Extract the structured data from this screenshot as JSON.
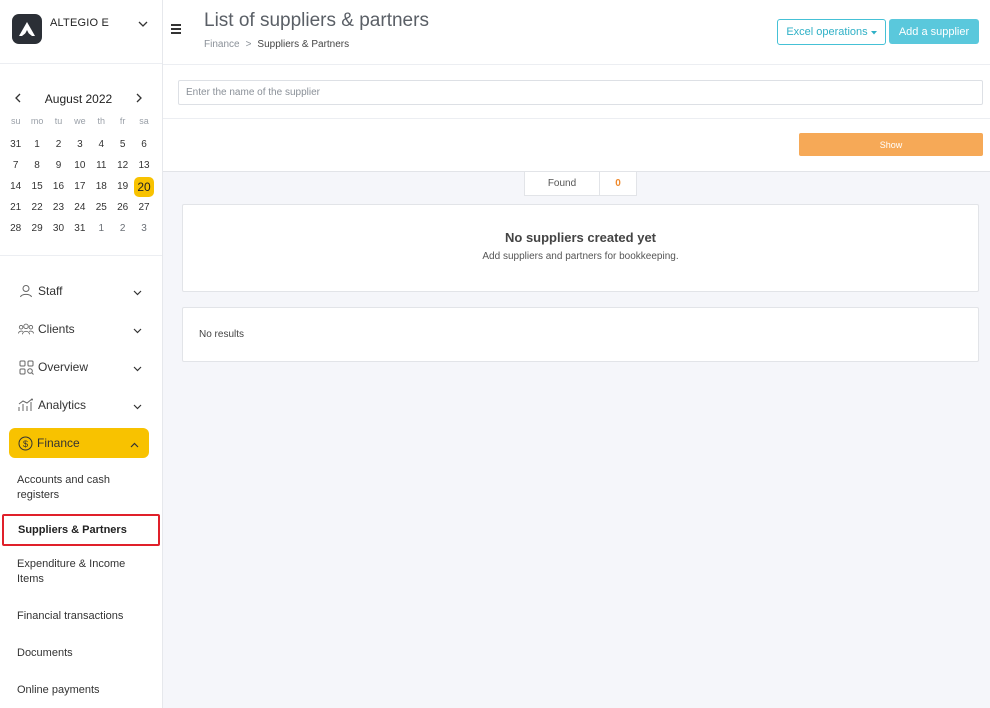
{
  "brand": {
    "name": "ALTEGIO E"
  },
  "calendar": {
    "month_label": "August 2022",
    "weekdays": [
      "su",
      "mo",
      "tu",
      "we",
      "th",
      "fr",
      "sa"
    ],
    "weeks": [
      [
        "31",
        "1",
        "2",
        "3",
        "4",
        "5",
        "6"
      ],
      [
        "7",
        "8",
        "9",
        "10",
        "11",
        "12",
        "13"
      ],
      [
        "14",
        "15",
        "16",
        "17",
        "18",
        "19",
        "20"
      ],
      [
        "21",
        "22",
        "23",
        "24",
        "25",
        "26",
        "27"
      ],
      [
        "28",
        "29",
        "30",
        "31",
        "1",
        "2",
        "3"
      ]
    ],
    "selected_day": "20",
    "accent_color": "#f8c200"
  },
  "nav": {
    "staff": "Staff",
    "clients": "Clients",
    "overview": "Overview",
    "analytics": "Analytics",
    "finance": "Finance",
    "finance_sub": {
      "accounts": "Accounts and cash registers",
      "suppliers": "Suppliers & Partners",
      "expenditure": "Expenditure & Income Items",
      "transactions": "Financial transactions",
      "documents": "Documents",
      "online_payments": "Online payments"
    }
  },
  "header": {
    "title": "List of suppliers & partners",
    "breadcrumb": {
      "parent": "Finance",
      "separator": ">",
      "current": "Suppliers & Partners"
    },
    "excel_button": "Excel operations",
    "add_button": "Add a supplier"
  },
  "filter": {
    "search_placeholder": "Enter the name of the supplier",
    "search_value": "",
    "show_button": "Show"
  },
  "results": {
    "found_label": "Found",
    "found_count": "0",
    "empty_title": "No suppliers created yet",
    "empty_subtitle": "Add suppliers and partners for bookkeeping.",
    "no_results": "No results"
  },
  "colors": {
    "show_button": "#f6a957",
    "add_button": "#5ac8dc",
    "excel_border": "#45c1d6",
    "highlight_box": "#e0202a"
  }
}
